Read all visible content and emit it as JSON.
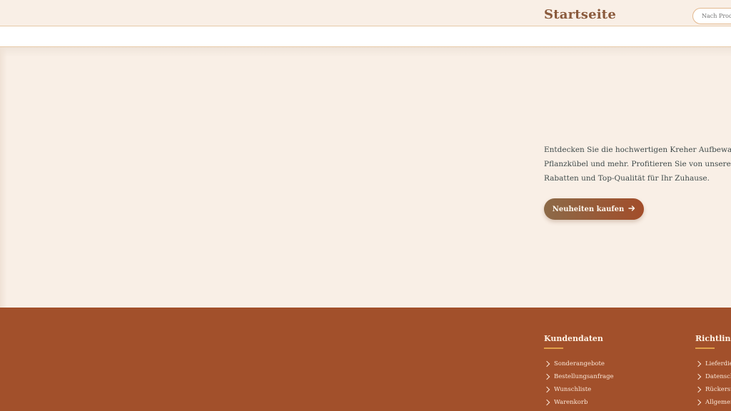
{
  "header": {
    "title": "Startseite",
    "search_placeholder": "Nach Produkten suchen"
  },
  "hero": {
    "description_lines": [
      "Entdecken Sie die hochwertigen Kreher Aufbewahrungsbo",
      "Pflanzkübel und mehr. Profitieren Sie von unseren exklusi",
      "Rabatten und Top-Qualität für Ihr Zuhause."
    ],
    "cta_label": "Neuheiten kaufen",
    "cta_icon": "arrow-right-icon"
  },
  "footer": {
    "columns": [
      {
        "heading": "Kundendaten",
        "links": [
          "Sonderangebote",
          "Bestellungsanfrage",
          "Wunschliste",
          "Warenkorb"
        ]
      },
      {
        "heading": "Richtlinie",
        "links": [
          "Lieferdien",
          "Datenschu",
          "Rückersta",
          "Allgemein"
        ]
      }
    ],
    "link_icon": "chevron-right-icon"
  },
  "colors": {
    "background": "#f9efe6",
    "brand_brown": "#8a5a3c",
    "footer_rust": "#a2502b",
    "accent_gold": "#e0a04a"
  }
}
